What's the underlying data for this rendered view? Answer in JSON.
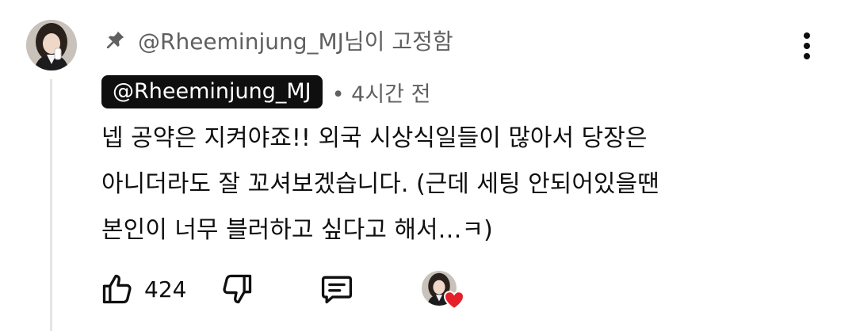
{
  "pin": {
    "text": "@Rheeminjung_MJ님이 고정함",
    "icon": "pin-icon"
  },
  "comment": {
    "author": "@Rheeminjung_MJ",
    "meta": "• 4시간 전",
    "lines": [
      "넵 공약은 지켜야죠!! 외국 시상식일들이 많아서 당장은",
      "아니더라도 잘 꼬셔보겠습니다. (근데 세팅 안되어있을땐",
      "본인이 너무 블러하고 싶다고 해서…ㅋ)"
    ]
  },
  "actions": {
    "like_count": "424",
    "like_icon": "thumbs-up-icon",
    "dislike_icon": "thumbs-down-icon",
    "reply_icon": "comment-icon",
    "creator_heart_icon": "heart-icon"
  },
  "colors": {
    "text": "#0f0f0f",
    "secondary": "#606060",
    "chip_bg": "#0f0f0f",
    "heart": "#e5202a",
    "thread_line": "#e5e5e5"
  }
}
